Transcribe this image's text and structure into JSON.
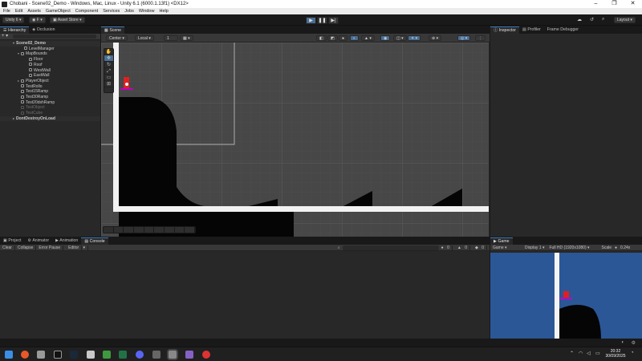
{
  "window": {
    "title": "Chobani - Scene02_Demo - Windows, Mac, Linux - Unity 6.1 (6000.1.13f1) <DX12>",
    "controls": [
      "–",
      "❐",
      "✕"
    ]
  },
  "menu": [
    "File",
    "Edit",
    "Assets",
    "GameObject",
    "Component",
    "Services",
    "Jobs",
    "Window",
    "Help"
  ],
  "toolbar": {
    "unity_label": "Unity 6",
    "account_label": "F",
    "asset_store_label": "Asset Store",
    "layout_label": "Layout"
  },
  "hierarchy": {
    "tab_label": "Hierarchy",
    "tab2_label": "Occlusion",
    "items": [
      {
        "label": "Scene02_Demo",
        "kind": "scene"
      },
      {
        "label": "LevelManager",
        "kind": "object"
      },
      {
        "label": "MapBounds",
        "kind": "object",
        "expanded": true
      },
      {
        "label": "Floor",
        "kind": "child"
      },
      {
        "label": "Roof",
        "kind": "child"
      },
      {
        "label": "WestWall",
        "kind": "child"
      },
      {
        "label": "EastWall",
        "kind": "child"
      },
      {
        "label": "PlayerObject",
        "kind": "object"
      },
      {
        "label": "TestRollo",
        "kind": "object"
      },
      {
        "label": "Test15Ramp",
        "kind": "object"
      },
      {
        "label": "Test30Ramp",
        "kind": "object"
      },
      {
        "label": "Test20dshRamp",
        "kind": "object"
      },
      {
        "label": "TestObject",
        "kind": "disabled"
      },
      {
        "label": "TestCube",
        "kind": "disabled"
      },
      {
        "label": "DontDestroyOnLoad",
        "kind": "scene"
      }
    ]
  },
  "scene": {
    "tab_label": "Scene",
    "pivot_label": "Center",
    "space_label": "Local",
    "grid_value": "1"
  },
  "inspector": {
    "tab_label": "Inspector",
    "tab2_label": "Profiler",
    "tab3_label": "Frame Debugger"
  },
  "bottom": {
    "tab_project": "Project",
    "tab_animator": "Animator",
    "tab_animation": "Animation",
    "tab_console": "Console",
    "console_buttons": [
      "Clear",
      "Collapse",
      "Error Pause",
      "Editor"
    ],
    "counts": [
      "0",
      "0",
      "0"
    ]
  },
  "game": {
    "tab_label": "Game",
    "mode_label": "Game",
    "display_label": "Display 1",
    "resolution_label": "Full HD (1920x1080)",
    "scale_label": "Scale",
    "scale_value": "0.24x"
  },
  "taskbar": {
    "time": "20:32",
    "date": "30/09/2025"
  },
  "colors": {
    "accent": "#3a79bb",
    "player": "#e02020",
    "platform": "#c000c0",
    "game_bg": "#2b5797"
  }
}
